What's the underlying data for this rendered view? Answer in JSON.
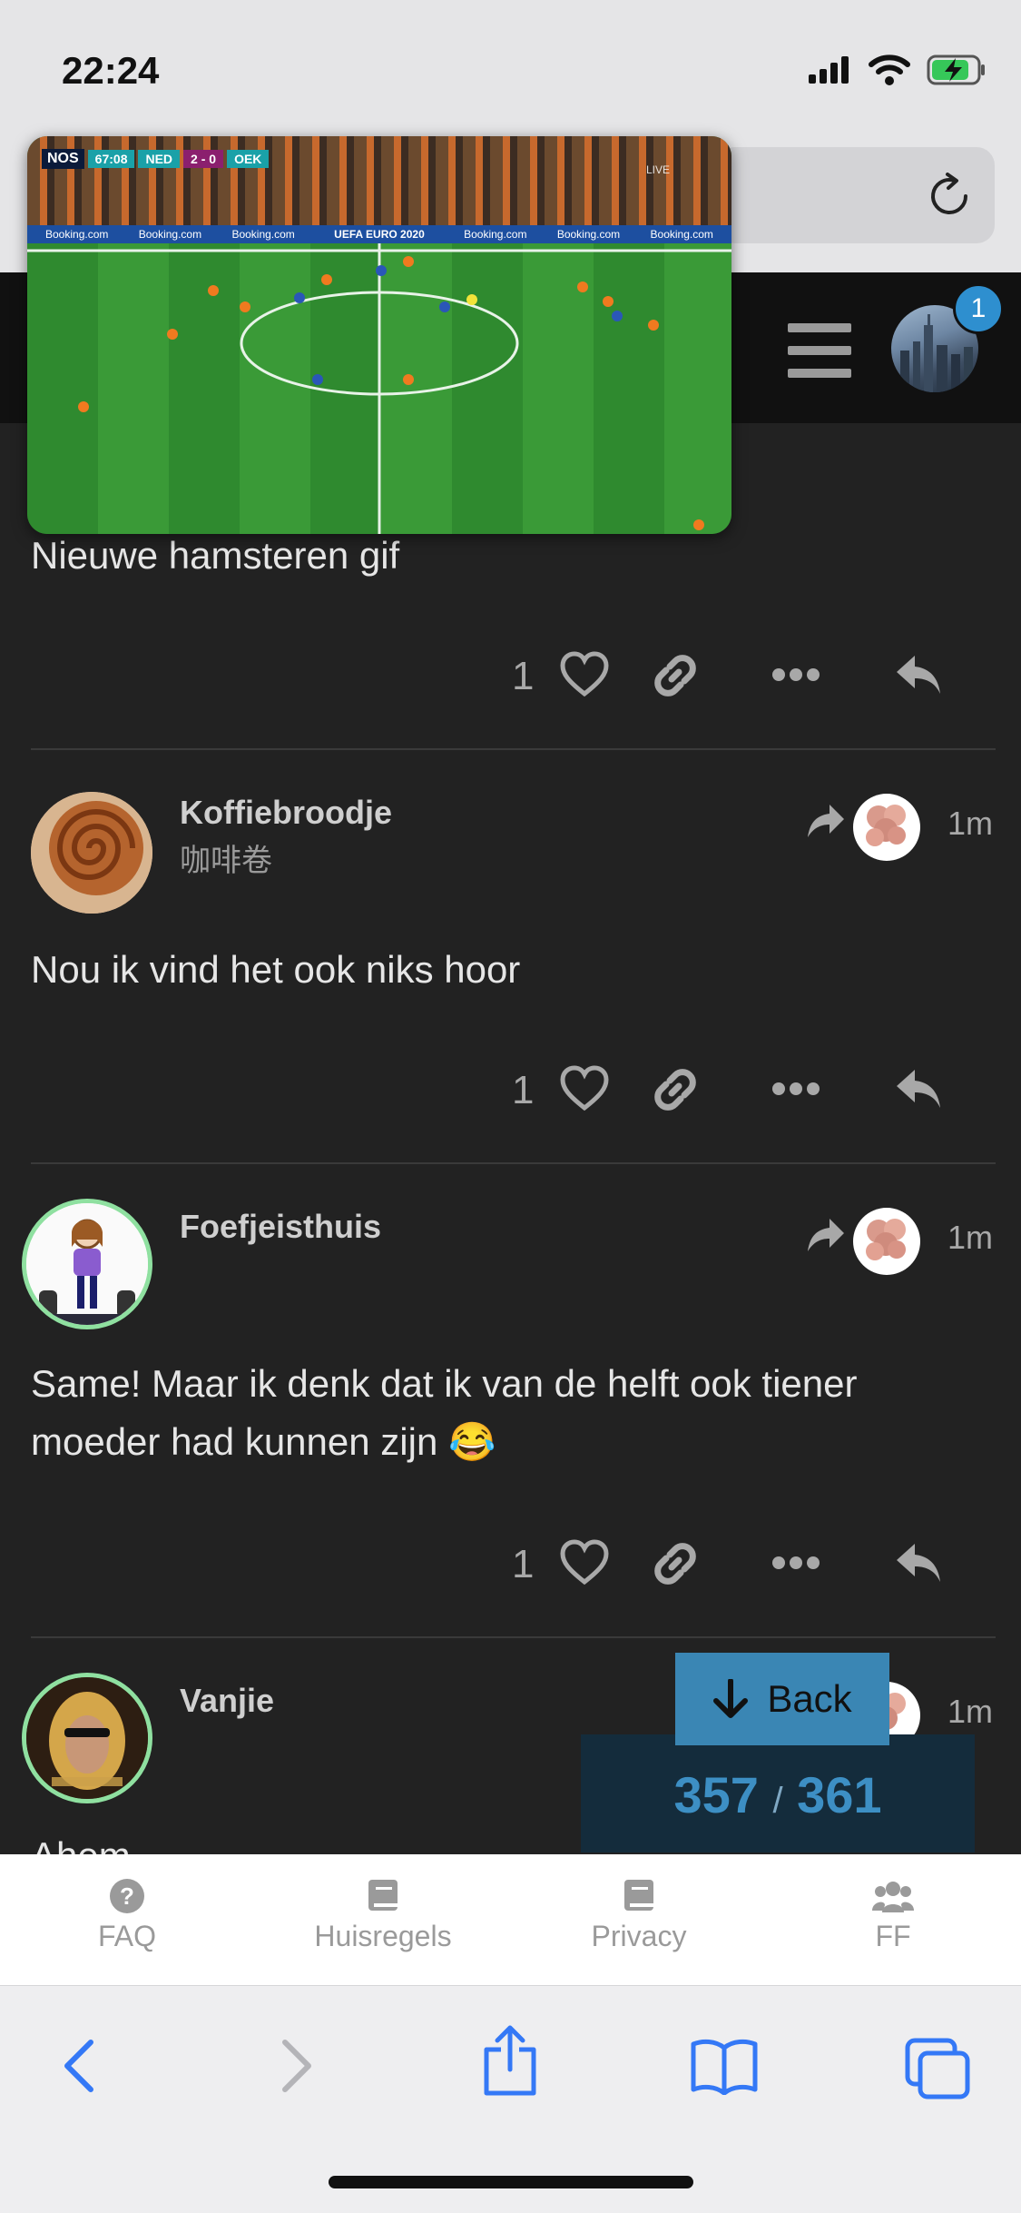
{
  "status": {
    "time": "22:24"
  },
  "video": {
    "broadcaster": "NOS",
    "clock": "67:08",
    "home_team": "NED",
    "score": "2 - 0",
    "away_team": "OEK",
    "tournament": "UEFA EURO 2020",
    "sponsor": "Booking.com",
    "live_label": "LIVE"
  },
  "header": {
    "notification_count": "1"
  },
  "posts": [
    {
      "text": "Nieuwe hamsteren gif",
      "likes": "1"
    },
    {
      "username": "Koffiebroodje",
      "subtitle": "咖啡卷",
      "time": "1m",
      "text": "Nou ik vind het ook niks hoor",
      "likes": "1"
    },
    {
      "username": "Foefjeisthuis",
      "time": "1m",
      "text": "Same! Maar ik denk dat ik van de helft ook tiener moeder had kunnen zijn 😂",
      "likes": "1"
    },
    {
      "username": "Vanjie",
      "time": "1m",
      "text": "Ahem"
    }
  ],
  "back_button": {
    "label": "Back"
  },
  "progress": {
    "current": "357",
    "separator": "/",
    "total": "361"
  },
  "footer": {
    "items": [
      {
        "label": "FAQ",
        "icon": "question-circle-icon"
      },
      {
        "label": "Huisregels",
        "icon": "book-icon"
      },
      {
        "label": "Privacy",
        "icon": "book-icon"
      },
      {
        "label": "FF",
        "icon": "users-icon"
      }
    ]
  },
  "colors": {
    "background": "#222222",
    "accent": "#3a86b4",
    "progress": "#3d8fc4",
    "ring": "#8fe0a0"
  }
}
